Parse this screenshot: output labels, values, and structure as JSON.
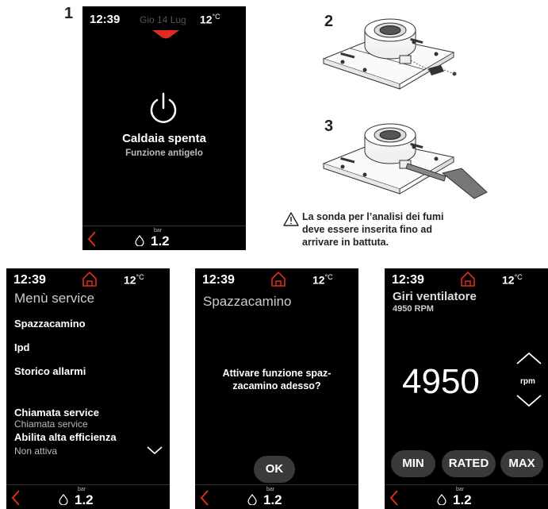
{
  "steps": [
    "1",
    "2",
    "3"
  ],
  "screen1": {
    "time": "12:39",
    "date": "Gio 14 Lug",
    "temp": "12",
    "temp_unit": "°C",
    "title": "Caldaia spenta",
    "subtitle": "Funzione antigelo",
    "pressure_unit": "bar",
    "pressure": "1.2"
  },
  "warning_note": {
    "line1": "La sonda per l’analisi dei fumi",
    "line2": "deve essere inserita fino ad",
    "line3": "arrivare in battuta."
  },
  "screen_menu": {
    "time": "12:39",
    "temp": "12",
    "temp_unit": "°C",
    "title": "Menù service",
    "items": [
      "Spazzacamino",
      "Ipd",
      "Storico allarmi",
      "Chiamata service"
    ],
    "item4_sub": "Chiamata service",
    "item5": "Abilita alta efficienza",
    "item5_sub": "Non attiva",
    "pressure_unit": "bar",
    "pressure": "1.2"
  },
  "screen_chimney": {
    "time": "12:39",
    "temp": "12",
    "temp_unit": "°C",
    "title": "Spazzacamino",
    "question_l1": "Attivare funzione spaz-",
    "question_l2": "zacamino adesso?",
    "ok": "OK",
    "pressure_unit": "bar",
    "pressure": "1.2"
  },
  "screen_fan": {
    "time": "12:39",
    "temp": "12",
    "temp_unit": "°C",
    "title": "Giri ventilatore",
    "subtitle": "4950 RPM",
    "value": "4950",
    "unit": "rpm",
    "btn_min": "MIN",
    "btn_rated": "RATED",
    "btn_max": "MAX",
    "pressure_unit": "bar",
    "pressure": "1.2"
  },
  "colors": {
    "accent_red": "#e02b1e",
    "screen_bg": "#000000",
    "pill_bg": "#3a3a3a"
  }
}
